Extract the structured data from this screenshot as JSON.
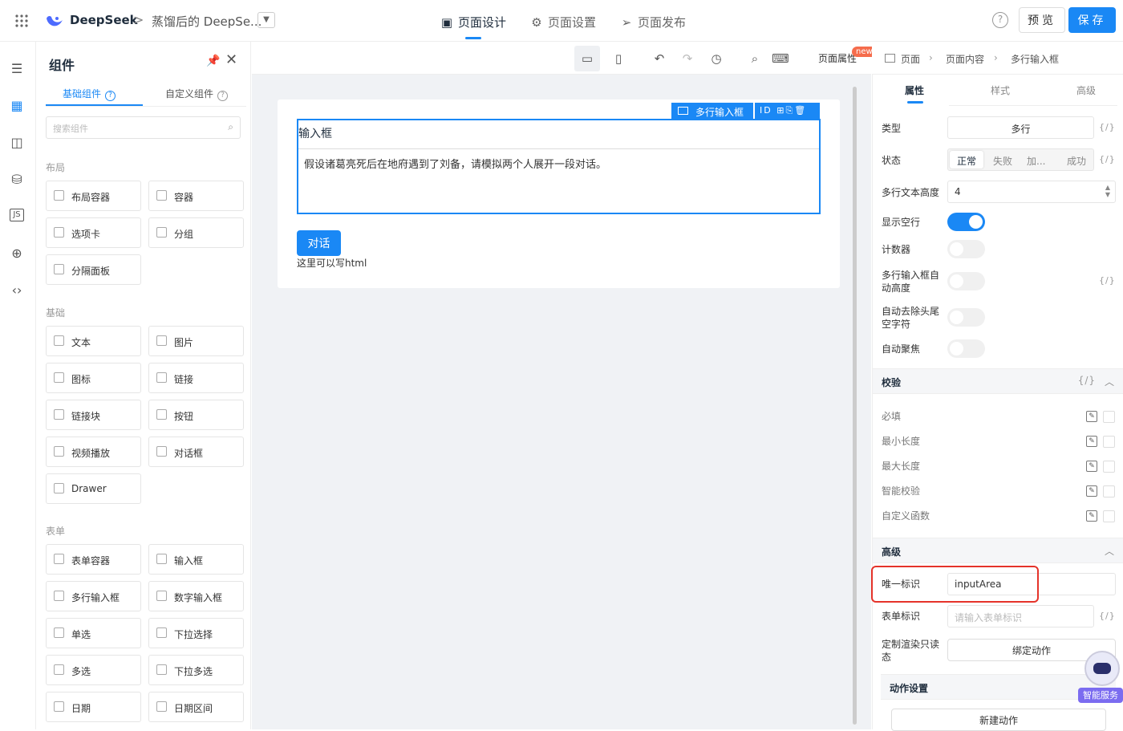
{
  "header": {
    "brand": "DeepSeek",
    "crumb_sep": ">",
    "app_name": "蒸馏后的 DeepSe...",
    "tabs": [
      {
        "label": "页面设计",
        "icon": "layout-icon"
      },
      {
        "label": "页面设置",
        "icon": "gear-icon"
      },
      {
        "label": "页面发布",
        "icon": "send-icon"
      }
    ],
    "help": "?",
    "preview_label": "预览",
    "save_label": "保存"
  },
  "components": {
    "title": "组件",
    "tabs": [
      "基础组件",
      "自定义组件"
    ],
    "search_placeholder": "搜索组件",
    "sections": [
      {
        "title": "布局",
        "items": [
          "布局容器",
          "容器",
          "选项卡",
          "分组",
          "分隔面板"
        ]
      },
      {
        "title": "基础",
        "items": [
          "文本",
          "图片",
          "图标",
          "链接",
          "链接块",
          "按钮",
          "视频播放",
          "对话框",
          "Drawer"
        ]
      },
      {
        "title": "表单",
        "items": [
          "表单容器",
          "输入框",
          "多行输入框",
          "数字输入框",
          "单选",
          "下拉选择",
          "多选",
          "下拉多选",
          "日期",
          "日期区间"
        ]
      }
    ]
  },
  "toolbar": {
    "page_attr": "页面属性",
    "new_badge": "new"
  },
  "breadcrumb": [
    "页面",
    "页面内容",
    "多行输入框"
  ],
  "canvas": {
    "selected_label": "多行输入框",
    "selected_tools": "ID",
    "field_label": "输入框",
    "field_text": "假设诸葛亮死后在地府遇到了刘备，请模拟两个人展开一段对话。",
    "button_label": "对话",
    "html_note": "这里可以写html"
  },
  "props": {
    "tabs": [
      "属性",
      "样式",
      "高级"
    ],
    "code": "{/}",
    "type_label": "类型",
    "type_value": "多行",
    "state_label": "状态",
    "state_options": [
      "正常",
      "失败",
      "加...",
      "成功"
    ],
    "rows_label": "多行文本高度",
    "rows_value": "4",
    "show_empty_label": "显示空行",
    "counter_label": "计数器",
    "autoheight_label": "多行输入框自动高度",
    "trim_label": "自动去除头尾空字符",
    "autofocus_label": "自动聚焦",
    "validation_title": "校验",
    "validations": [
      "必填",
      "最小长度",
      "最大长度",
      "智能校验",
      "自定义函数"
    ],
    "advanced_title": "高级",
    "uid_label": "唯一标识",
    "uid_value": "inputArea",
    "form_id_label": "表单标识",
    "form_id_placeholder": "请输入表单标识",
    "readonly_label": "定制渲染只读态",
    "bind_action": "绑定动作",
    "action_title": "动作设置",
    "new_action": "新建动作",
    "assistant_label": "智能服务"
  },
  "colors": {
    "accent": "#1a88f5",
    "highlight": "#e5332a"
  }
}
